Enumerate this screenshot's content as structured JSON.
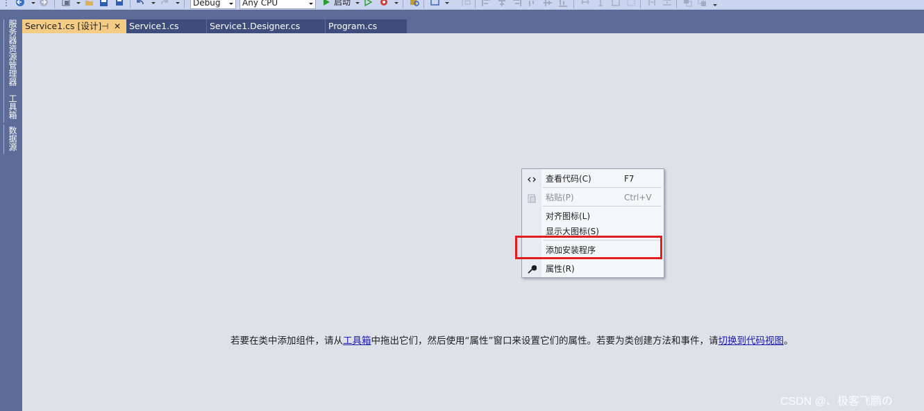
{
  "toolbar": {
    "config_select": "Debug",
    "platform_select": "Any CPU",
    "start_label": "启动"
  },
  "side_panels": [
    "服务器资源管理器",
    "工具箱",
    "数据源"
  ],
  "tabs": [
    {
      "label": "Service1.cs [设计]",
      "active": true
    },
    {
      "label": "Service1.cs",
      "active": false
    },
    {
      "label": "Service1.Designer.cs",
      "active": false
    },
    {
      "label": "Program.cs",
      "active": false
    }
  ],
  "context_menu": {
    "items": [
      {
        "label": "查看代码(C)",
        "shortcut": "F7",
        "icon": "code-icon",
        "enabled": true
      },
      {
        "label": "粘贴(P)",
        "shortcut": "Ctrl+V",
        "icon": "paste-icon",
        "enabled": false
      },
      {
        "label": "对齐图标(L)",
        "shortcut": "",
        "icon": "",
        "enabled": true
      },
      {
        "label": "显示大图标(S)",
        "shortcut": "",
        "icon": "",
        "enabled": true
      },
      {
        "label": "添加安装程序",
        "shortcut": "",
        "icon": "",
        "enabled": true,
        "highlighted": true
      },
      {
        "label": "属性(R)",
        "shortcut": "",
        "icon": "wrench-icon",
        "enabled": true
      }
    ]
  },
  "hint": {
    "part1": "若要在类中添加组件，请从",
    "link1": "工具箱",
    "part2": "中拖出它们，然后使用“属性”窗口来设置它们的属性。若要为类创建方法和事件，请",
    "link2": "切换到代码视图",
    "part3": "。"
  },
  "watermark": "CSDN @、极客飞鹏の",
  "colors": {
    "panel": "#5d6b99",
    "active_tab": "#f5cc84",
    "surface": "#dee1e8",
    "highlight_border": "#e21c1c",
    "link": "#1a1aaf"
  }
}
